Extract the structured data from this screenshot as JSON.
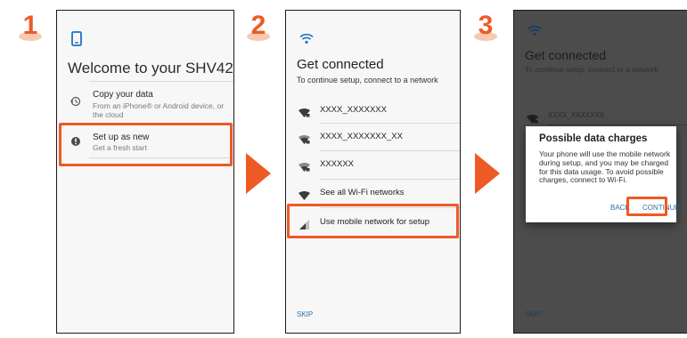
{
  "steps": {
    "one": "1",
    "two": "2",
    "three": "3"
  },
  "screen1": {
    "title": "Welcome to your SHV42",
    "options": [
      {
        "title": "Copy your data",
        "subtitle": "From an iPhone® or Android device, or the cloud",
        "icon": "restore-icon"
      },
      {
        "title": "Set up as new",
        "subtitle": "Get a fresh start",
        "icon": "new-device-icon"
      }
    ]
  },
  "screen2": {
    "title": "Get connected",
    "subtitle": "To continue setup, connect to a network",
    "networks": [
      {
        "label": "XXXX_XXXXXXX",
        "icon": "wifi-lock-icon"
      },
      {
        "label": "XXXX_XXXXXXX_XX",
        "icon": "wifi-lock-icon"
      },
      {
        "label": "XXXXXX",
        "icon": "wifi-lock-icon"
      },
      {
        "label": "See all Wi-Fi networks",
        "icon": "wifi-icon"
      },
      {
        "label": "Use mobile network for setup",
        "icon": "cellular-signal-icon"
      }
    ],
    "skip": "SKIP"
  },
  "screen3": {
    "title": "Get connected",
    "subtitle": "To continue setup, connect to a network",
    "network": "XXXX_XXXXXXX",
    "dialog": {
      "title": "Possible data charges",
      "body": "Your phone will use the mobile network during setup, and you may be charged for this data usage. To avoid possible charges, connect to Wi-Fi.",
      "back": "BACK",
      "continue": "CONTINUE"
    },
    "skip": "SKIP"
  },
  "colors": {
    "accent": "#ee5a24",
    "link": "#2f6fa8",
    "icon_blue": "#1e73c8"
  }
}
